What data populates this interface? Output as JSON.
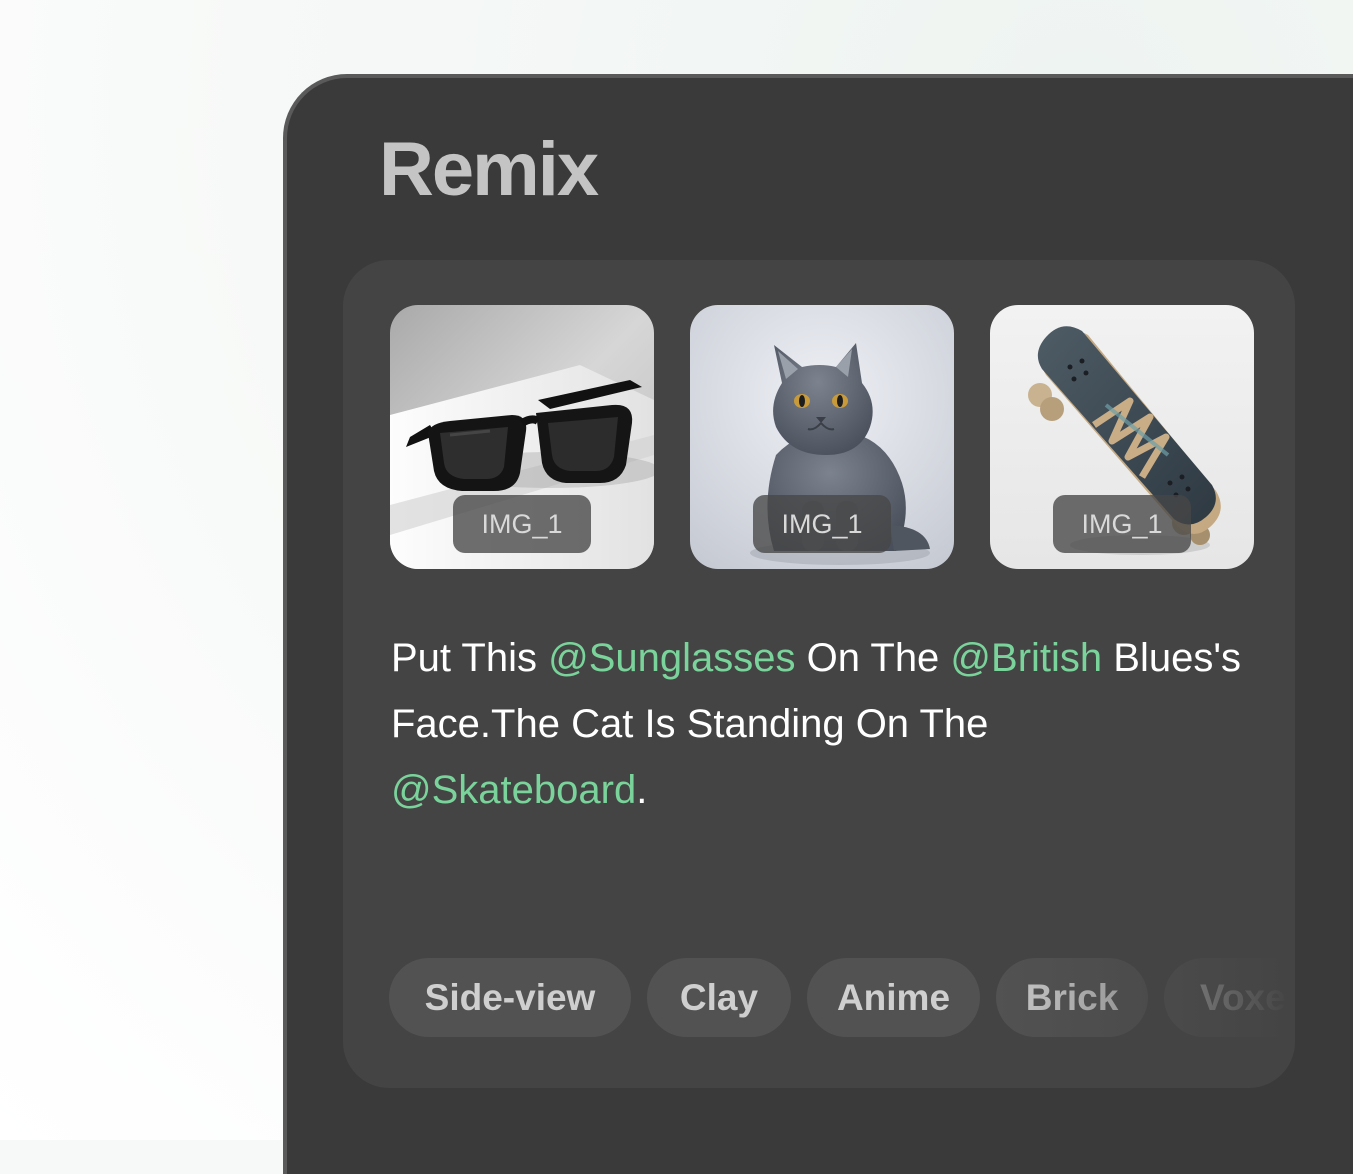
{
  "app": {
    "title": "Remix"
  },
  "images": [
    {
      "label": "IMG_1",
      "subject": "sunglasses"
    },
    {
      "label": "IMG_1",
      "subject": "cat"
    },
    {
      "label": "IMG_1",
      "subject": "skateboard"
    }
  ],
  "prompt": {
    "p1": "Put This ",
    "m1": "@Sunglasses",
    "p2": " On The ",
    "m2": "@British",
    "p3": " Blues's Face.The Cat Is Standing On The ",
    "m3": "@Skateboard",
    "p4": "."
  },
  "styles": [
    "Side-view",
    "Clay",
    "Anime",
    "Brick",
    "Voxel"
  ],
  "colors": {
    "window_bg": "#3a3a3a",
    "card_bg": "#444444",
    "mention": "#79d39a",
    "chip_bg": "#525252"
  }
}
